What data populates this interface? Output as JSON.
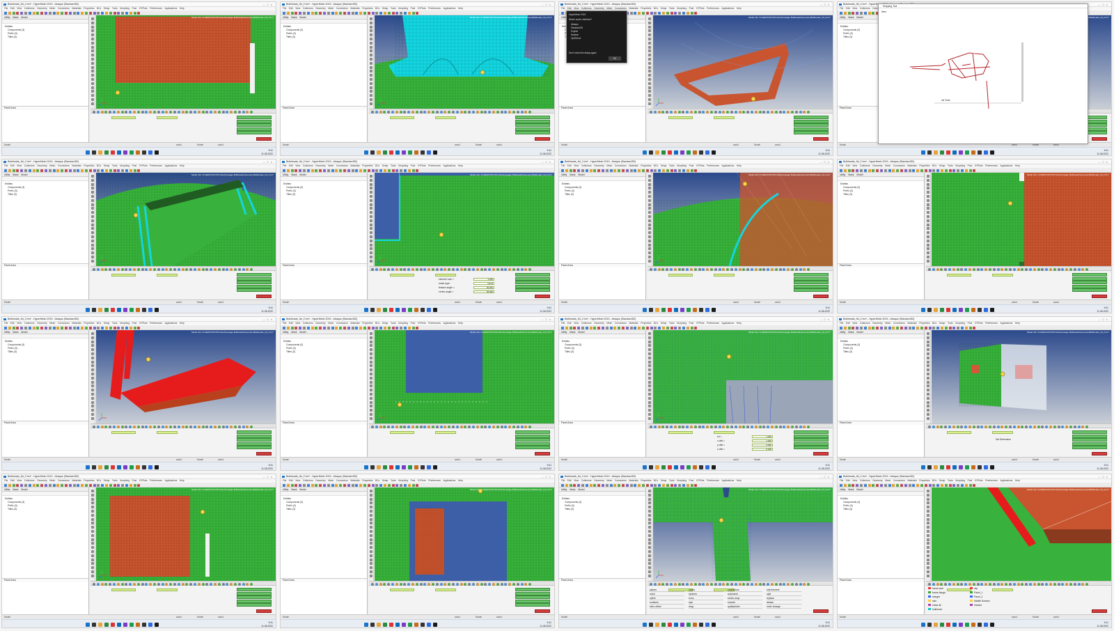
{
  "window": {
    "title": "Bulkheads_fld_2.hm* - HyperMesh 2019 - Abaqus (Standard3D)",
    "viewport_info": "Model Info: D:/AERO/CRJ700 Files/Fuselage Bulkheads/Geometry/Bulkheads_fld_2.hm*",
    "menu": [
      "File",
      "Edit",
      "View",
      "Collectors",
      "Geometry",
      "Mesh",
      "Connectors",
      "Materials",
      "Properties",
      "BCs",
      "Setup",
      "Tools",
      "Morphing",
      "Post",
      "XYPlots",
      "Preferences",
      "Applications",
      "Help"
    ],
    "browser_tabs": [
      "Utility",
      "Mask",
      "Model"
    ],
    "browser_tree": [
      "Entities",
      "Components (3)",
      "Prefix (3)",
      "Titles (3)"
    ],
    "status_left": "Model",
    "status_right_items": [
      "auto1",
      "Model",
      "auto1"
    ],
    "clock": {
      "time": "9:41",
      "date": "11-08-2022"
    }
  },
  "colors": {
    "mesh_green": "#38b23c",
    "shell_orange": "#c8552f",
    "edge_cyan": "#13d6e0",
    "frame_red": "#e61c1c",
    "bg_blue_top": "#2c4a8c",
    "bg_gray_bottom": "#c9ced6"
  },
  "tiles": [
    {
      "id": 1,
      "scene": "flat-orange-panel-on-green-mesh",
      "panel": "elem-cleanup",
      "panel_title": "Panel Area"
    },
    {
      "id": 2,
      "scene": "cyan-bulkhead-solid-on-cylinder",
      "panel": "mesh",
      "panel_title": "Panel Area"
    },
    {
      "id": 3,
      "scene": "dialog-over-orange-frame",
      "panel": "mesh",
      "panel_title": "Panel Area",
      "dialog": {
        "title": "HyperMesh 2019",
        "question": "Which solver interface?",
        "options": [
          "Abaqus",
          "Standard3D",
          "Explicit",
          "Nastran",
          "OptiStruct"
        ],
        "checkbox": "Don't show this dialog again",
        "ok": "OK"
      }
    },
    {
      "id": 4,
      "scene": "snipping-tool-sketch",
      "panel": "snip",
      "panel_title": "Panel Area",
      "snip": {
        "title": "Snipping Tool",
        "new": "New",
        "caption": "Ink Tools"
      }
    },
    {
      "id": 5,
      "scene": "cylinder-with-cyan-frame",
      "panel": "mesh",
      "panel_title": "Panel Area"
    },
    {
      "id": 6,
      "scene": "cutout-corner-green-mesh",
      "panel": "automesh",
      "panel_title": "Panel Area",
      "fields": [
        "element size =",
        "mesh type:",
        "feature angle =",
        "vertex angle ="
      ],
      "values": [
        "1.000",
        "mixed",
        "30.000",
        "30.000"
      ]
    },
    {
      "id": 7,
      "scene": "cylinder-orange-transition",
      "panel": "rigid",
      "panel_title": "Panel Area"
    },
    {
      "id": 8,
      "scene": "flat-green-orange-split",
      "panel": "elem-cleanup",
      "panel_title": "Panel Area"
    },
    {
      "id": 9,
      "scene": "red-frame-bulkhead",
      "panel": "mesh",
      "panel_title": "Panel Area"
    },
    {
      "id": 10,
      "scene": "green-window-cutout-points",
      "panel": "rigid",
      "panel_title": "Panel Area"
    },
    {
      "id": 11,
      "scene": "green-step-surface",
      "panel": "replace",
      "panel_title": "Panel Area",
      "fields": [
        "tol =",
        "x-dist =",
        "y-dist =",
        "z-dist ="
      ],
      "values": [
        "1.000",
        "1.000",
        "0.000",
        "0.000"
      ]
    },
    {
      "id": 12,
      "scene": "cylinder-transparent-section",
      "panel": "elem-cleanup",
      "panel_title": "Panel Area",
      "label": "Set Dimension"
    },
    {
      "id": 13,
      "scene": "flat-orange-panel-on-green-mesh-2",
      "panel": "elem-cleanup",
      "panel_title": "Panel Area"
    },
    {
      "id": 14,
      "scene": "orange-inset-panel",
      "panel": "rigid",
      "panel_title": "Panel Area"
    },
    {
      "id": 15,
      "scene": "green-t-junction",
      "panel": "2D-menu",
      "panel_title": "Panel Area",
      "menu_cols": [
        [
          "planes",
          "ruled",
          "spline",
          "surfaces",
          "elem offset"
        ],
        [
          "cones",
          "spheres",
          "torus",
          "spin",
          "drag"
        ],
        [
          "connectors",
          "automesh",
          "shrink wrap",
          "smooth",
          "qualityindex"
        ],
        [
          "edit element",
          "split",
          "replace",
          "detach",
          "order change"
        ]
      ]
    },
    {
      "id": 16,
      "scene": "red-beam-orange-block",
      "panel": "components",
      "panel_title": "Panel Area",
      "legend": [
        "frame-web",
        "frame-flange",
        "stringer",
        "skin",
        "shear-tie",
        "bulkhead",
        "clip",
        "Panel_1",
        "Panel_2",
        "Middle Surface",
        "Header"
      ]
    }
  ]
}
